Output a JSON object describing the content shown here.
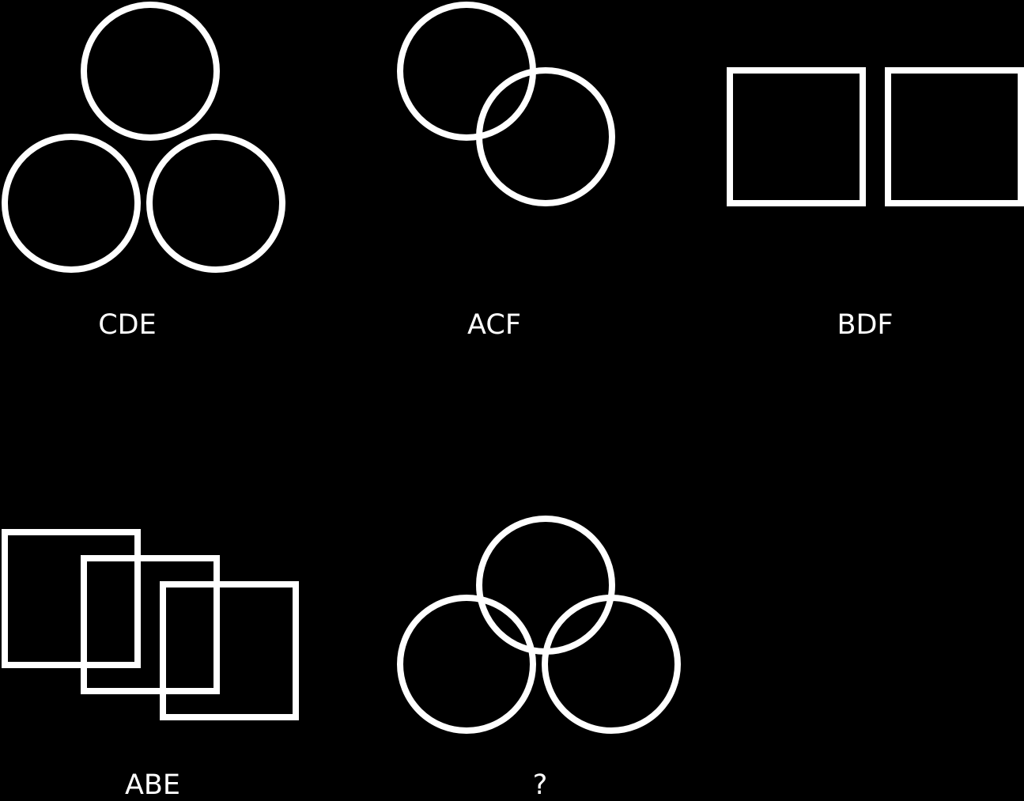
{
  "colors": {
    "background": "#000000",
    "stroke": "#ffffff",
    "text": "#ffffff"
  },
  "panels": [
    {
      "label": "CDE",
      "shape": "circle",
      "count": 3,
      "arrangement": "triangle, touching"
    },
    {
      "label": "ACF",
      "shape": "circle",
      "count": 2,
      "arrangement": "diagonal, overlapping"
    },
    {
      "label": "BDF",
      "shape": "square",
      "count": 2,
      "arrangement": "side by side, separate"
    },
    {
      "label": "ABE",
      "shape": "square",
      "count": 3,
      "arrangement": "diagonal, overlapping"
    },
    {
      "label": "?",
      "shape": "circle",
      "count": 3,
      "arrangement": "triangle, overlapping"
    }
  ]
}
